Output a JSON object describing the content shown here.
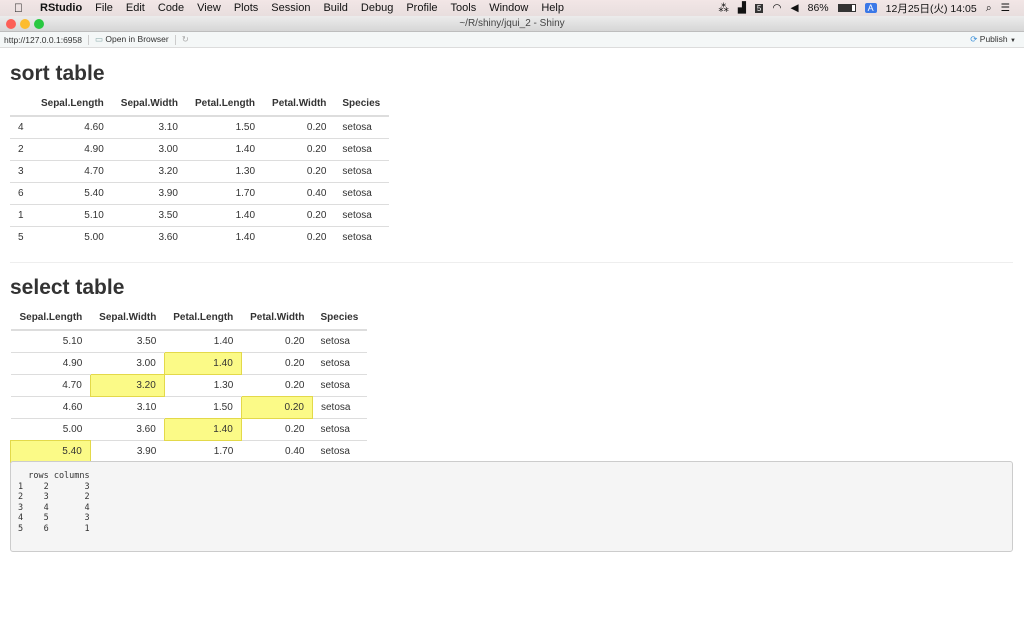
{
  "menubar": {
    "app": "RStudio",
    "items": [
      "File",
      "Edit",
      "Code",
      "View",
      "Plots",
      "Session",
      "Build",
      "Debug",
      "Profile",
      "Tools",
      "Window",
      "Help"
    ],
    "status": {
      "battery": "86%",
      "input": "A",
      "datetime": "12月25日(火)  14:05"
    }
  },
  "window": {
    "title": "~/R/shiny/jqui_2 - Shiny"
  },
  "toolbar": {
    "url": "http://127.0.0.1:6958",
    "open_browser": "Open in Browser",
    "publish": "Publish"
  },
  "sort_table": {
    "title": "sort table",
    "columns": [
      "",
      "Sepal.Length",
      "Sepal.Width",
      "Petal.Length",
      "Petal.Width",
      "Species"
    ],
    "rows": [
      [
        "4",
        "4.60",
        "3.10",
        "1.50",
        "0.20",
        "setosa"
      ],
      [
        "2",
        "4.90",
        "3.00",
        "1.40",
        "0.20",
        "setosa"
      ],
      [
        "3",
        "4.70",
        "3.20",
        "1.30",
        "0.20",
        "setosa"
      ],
      [
        "6",
        "5.40",
        "3.90",
        "1.70",
        "0.40",
        "setosa"
      ],
      [
        "1",
        "5.10",
        "3.50",
        "1.40",
        "0.20",
        "setosa"
      ],
      [
        "5",
        "5.00",
        "3.60",
        "1.40",
        "0.20",
        "setosa"
      ]
    ]
  },
  "select_table": {
    "title": "select table",
    "columns": [
      "Sepal.Length",
      "Sepal.Width",
      "Petal.Length",
      "Petal.Width",
      "Species"
    ],
    "rows": [
      [
        "5.10",
        "3.50",
        "1.40",
        "0.20",
        "setosa"
      ],
      [
        "4.90",
        "3.00",
        "1.40",
        "0.20",
        "setosa"
      ],
      [
        "4.70",
        "3.20",
        "1.30",
        "0.20",
        "setosa"
      ],
      [
        "4.60",
        "3.10",
        "1.50",
        "0.20",
        "setosa"
      ],
      [
        "5.00",
        "3.60",
        "1.40",
        "0.20",
        "setosa"
      ],
      [
        "5.40",
        "3.90",
        "1.70",
        "0.40",
        "setosa"
      ]
    ],
    "selected_cells": [
      [
        2,
        3
      ],
      [
        3,
        2
      ],
      [
        4,
        4
      ],
      [
        5,
        3
      ],
      [
        6,
        1
      ]
    ],
    "highlight_color": "#fbfa87"
  },
  "output": {
    "text": "  rows columns\n1    2       3\n2    3       2\n3    4       4\n4    5       3\n5    6       1"
  }
}
